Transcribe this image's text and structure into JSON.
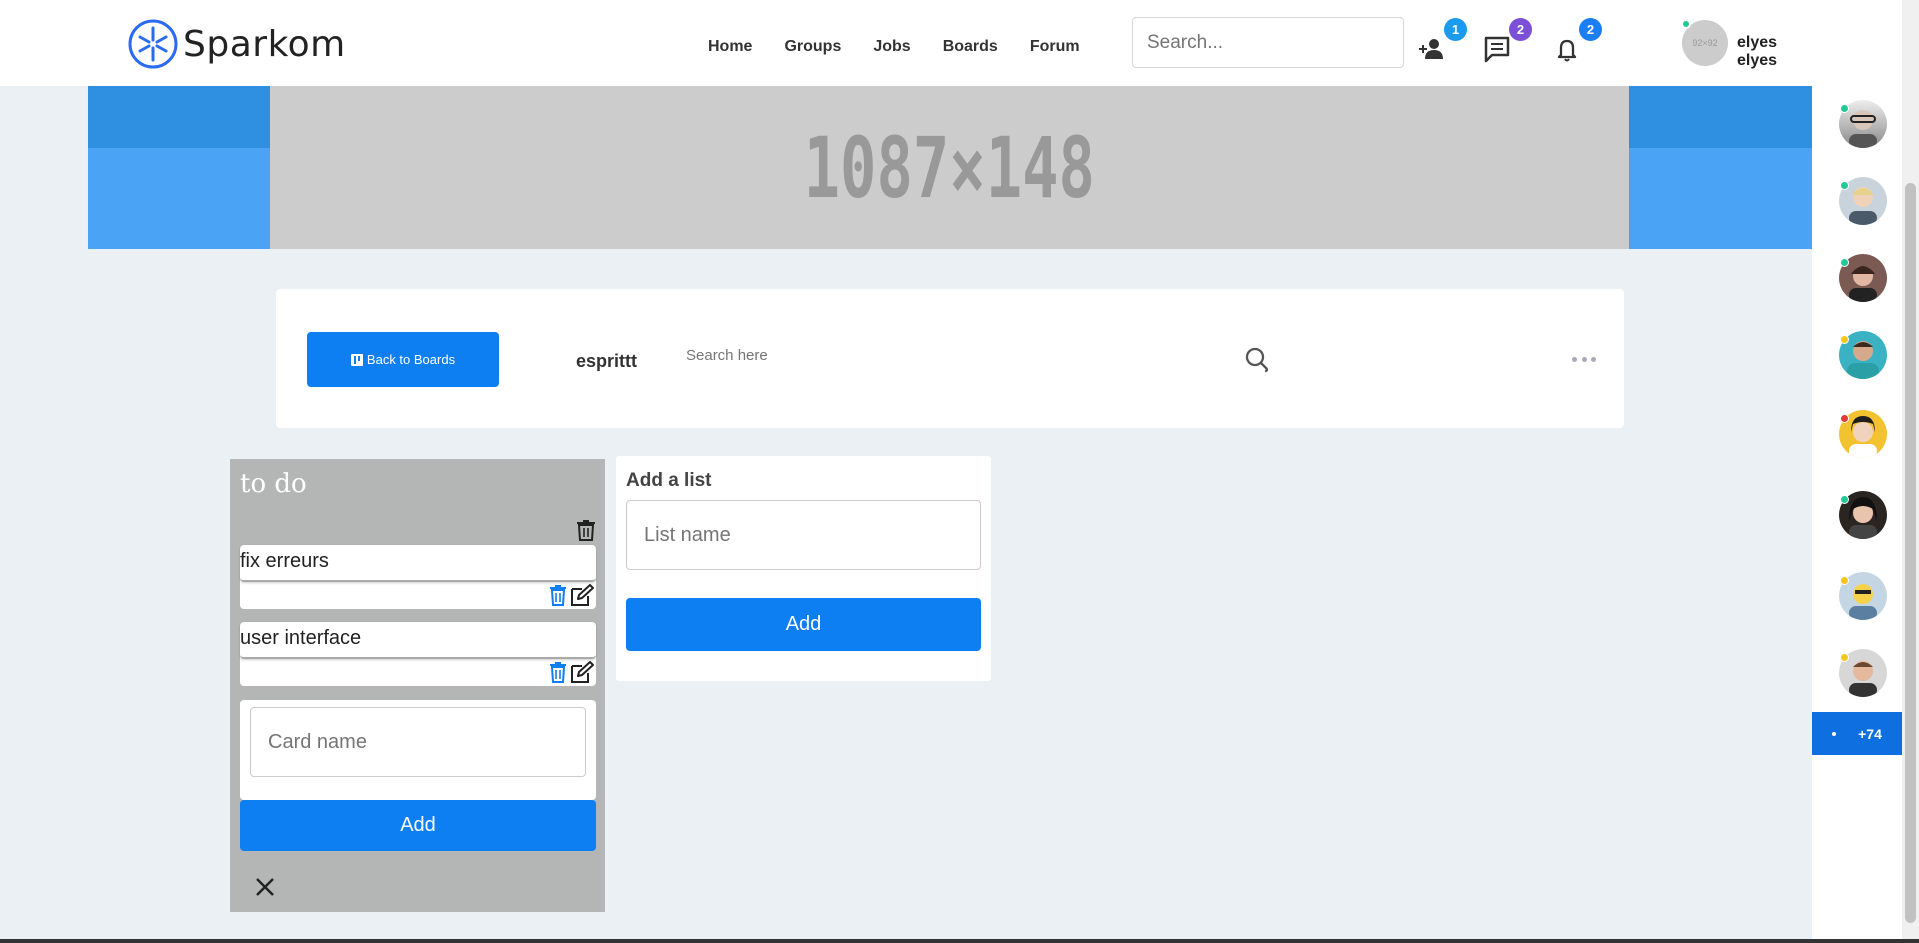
{
  "app": {
    "name": "Sparkom"
  },
  "nav": {
    "home": "Home",
    "groups": "Groups",
    "jobs": "Jobs",
    "boards": "Boards",
    "forum": "Forum"
  },
  "header": {
    "search_placeholder": "Search...",
    "friend_requests_count": "1",
    "messages_count": "2",
    "notifications_count": "2",
    "user_name": "elyes elyes",
    "user_avatar_text": "92×92"
  },
  "banner": {
    "placeholder_text": "1087×148"
  },
  "board": {
    "back_label": "Back to Boards",
    "name": "esprittt",
    "search_placeholder": "Search here"
  },
  "list": {
    "title": "to do",
    "cards": [
      {
        "title": "fix erreurs"
      },
      {
        "title": "user interface"
      }
    ],
    "card_input_placeholder": "Card name",
    "add_label": "Add"
  },
  "add_list": {
    "title": "Add a list",
    "input_placeholder": "List name",
    "add_label": "Add"
  },
  "sidebar": {
    "friends": [
      {
        "status": "online",
        "color": "#20c997"
      },
      {
        "status": "online",
        "color": "#20c997"
      },
      {
        "status": "online",
        "color": "#20c997"
      },
      {
        "status": "away",
        "color": "#f5c518"
      },
      {
        "status": "busy",
        "color": "#e53935"
      },
      {
        "status": "online",
        "color": "#20c997"
      },
      {
        "status": "away",
        "color": "#f5c518"
      },
      {
        "status": "away",
        "color": "#f5c518"
      }
    ],
    "more_label": "+74"
  },
  "colors": {
    "primary": "#0d7ff2",
    "badge_blue": "#1a9bf0",
    "badge_purple": "#7b4fd6",
    "list_bg": "#b4b5b5",
    "page_bg": "#ebf0f5"
  }
}
